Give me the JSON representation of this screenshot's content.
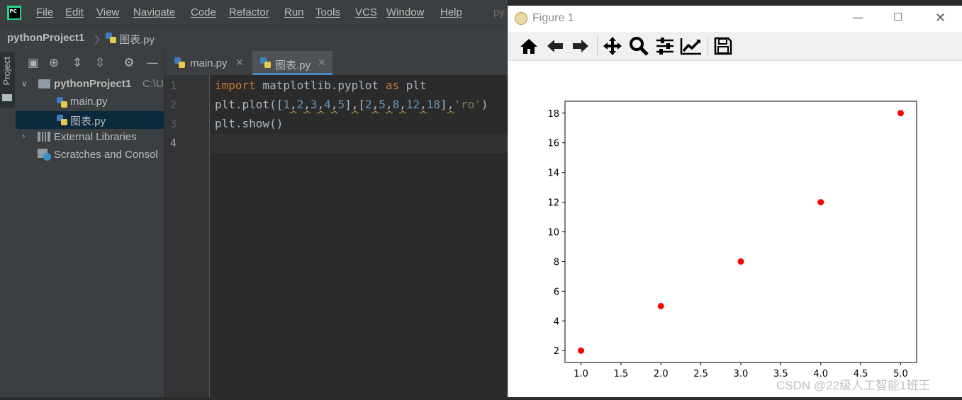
{
  "menubar": {
    "items": [
      "File",
      "Edit",
      "View",
      "Navigate",
      "Code",
      "Refactor",
      "Run",
      "Tools",
      "VCS",
      "Window",
      "Help"
    ],
    "tail": "py"
  },
  "navbar": {
    "project": "pythonProject1",
    "file": "图表.py"
  },
  "side": {
    "tab_label": "Project"
  },
  "project_panel": {
    "root": {
      "name": "pythonProject1",
      "path": "C:\\U"
    },
    "files": [
      "main.py",
      "图表.py"
    ],
    "external_libraries": "External Libraries",
    "scratches": "Scratches and Consol"
  },
  "editor": {
    "tabs": [
      {
        "label": "main.py"
      },
      {
        "label": "图表.py"
      }
    ],
    "line_numbers": [
      "1",
      "2",
      "3",
      "4"
    ],
    "code": {
      "line1": {
        "kw1": "import",
        "mod": " matplotlib.pyplot ",
        "kw2": "as",
        "alias": " plt"
      },
      "line2": {
        "pre": "plt.plot([",
        "n1": "1",
        "n2": "2",
        "n3": "3",
        "n4": "4",
        "n5": "5",
        "mid": "[",
        "m1": "2",
        "m2": "5",
        "m3": "8",
        "m4": "12",
        "m5": "18",
        "str": "'ro'",
        "end": ")"
      },
      "line3": "plt.show()"
    }
  },
  "figure": {
    "title": "Figure 1",
    "toolbar_icons": [
      "home-icon",
      "back-icon",
      "forward-icon",
      "pan-icon",
      "zoom-icon",
      "configure-subplots-icon",
      "edit-axes-icon",
      "save-icon"
    ]
  },
  "chart_data": {
    "type": "scatter",
    "x": [
      1,
      2,
      3,
      4,
      5
    ],
    "y": [
      2,
      5,
      8,
      12,
      18
    ],
    "marker_color": "#ff0000",
    "xlim": [
      0.8,
      5.2
    ],
    "ylim": [
      1.2,
      18.8
    ],
    "xticks": [
      "1.0",
      "1.5",
      "2.0",
      "2.5",
      "3.0",
      "3.5",
      "4.0",
      "4.5",
      "5.0"
    ],
    "yticks": [
      "2",
      "4",
      "6",
      "8",
      "10",
      "12",
      "14",
      "16",
      "18"
    ],
    "title": "",
    "xlabel": "",
    "ylabel": ""
  },
  "watermark": "CSDN @22级人工智能1班王"
}
